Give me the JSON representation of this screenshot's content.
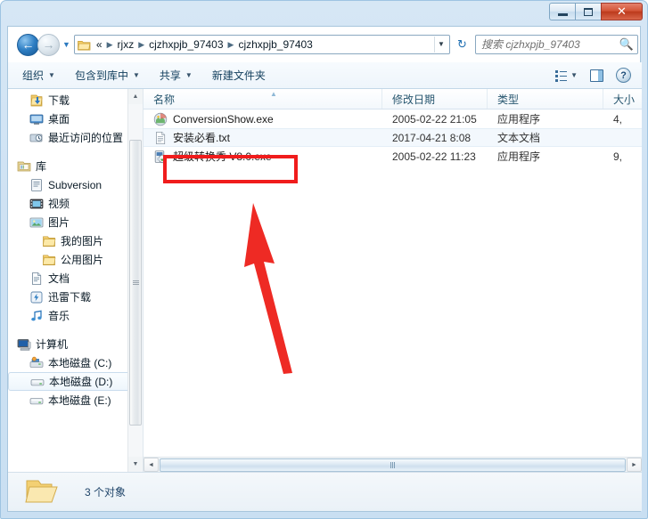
{
  "window": {
    "controls": {
      "minimize": "minimize-button",
      "maximize": "maximize-button",
      "close_label": "✕"
    }
  },
  "nav": {
    "back_glyph": "←",
    "forward_glyph": "→",
    "recent_caret": "▼",
    "breadcrumbs": [
      {
        "label": "«"
      },
      {
        "label": "rjxz"
      },
      {
        "label": "cjzhxpjb_97403"
      },
      {
        "label": "cjzhxpjb_97403"
      }
    ],
    "address_dropdown_glyph": "▼",
    "refresh_glyph": "↻",
    "search": {
      "placeholder": "搜索 cjzhxpjb_97403",
      "value": "",
      "icon": "search-icon"
    }
  },
  "toolbar": {
    "items": [
      {
        "label": "组织",
        "caret": "▼"
      },
      {
        "label": "包含到库中",
        "caret": "▼"
      },
      {
        "label": "共享",
        "caret": "▼"
      },
      {
        "label": "新建文件夹",
        "caret": ""
      }
    ],
    "view_caret": "▼",
    "help_label": "?"
  },
  "sidebar": {
    "items": [
      {
        "label": "下载",
        "icon": "downloads-icon",
        "indent": 1,
        "selected": false
      },
      {
        "label": "桌面",
        "icon": "desktop-icon",
        "indent": 1,
        "selected": false
      },
      {
        "label": "最近访问的位置",
        "icon": "recent-places-icon",
        "indent": 1,
        "selected": false
      },
      {
        "label": "库",
        "icon": "library-icon",
        "indent": 0,
        "selected": false,
        "gap_before": true
      },
      {
        "label": "Subversion",
        "icon": "subversion-icon",
        "indent": 1,
        "selected": false
      },
      {
        "label": "视频",
        "icon": "videos-icon",
        "indent": 1,
        "selected": false
      },
      {
        "label": "图片",
        "icon": "pictures-icon",
        "indent": 1,
        "selected": false
      },
      {
        "label": "我的图片",
        "icon": "folder-icon",
        "indent": 2,
        "selected": false
      },
      {
        "label": "公用图片",
        "icon": "folder-icon",
        "indent": 2,
        "selected": false
      },
      {
        "label": "文档",
        "icon": "documents-icon",
        "indent": 1,
        "selected": false
      },
      {
        "label": "迅雷下载",
        "icon": "thunder-download-icon",
        "indent": 1,
        "selected": false
      },
      {
        "label": "音乐",
        "icon": "music-icon",
        "indent": 1,
        "selected": false
      },
      {
        "label": "计算机",
        "icon": "computer-icon",
        "indent": 0,
        "selected": false,
        "gap_before": true
      },
      {
        "label": "本地磁盘 (C:)",
        "icon": "system-drive-icon",
        "indent": 1,
        "selected": false
      },
      {
        "label": "本地磁盘 (D:)",
        "icon": "drive-icon",
        "indent": 1,
        "selected": true
      },
      {
        "label": "本地磁盘 (E:)",
        "icon": "drive-icon",
        "indent": 1,
        "selected": false
      }
    ],
    "scroll": {
      "up_glyph": "▲",
      "down_glyph": "▼"
    }
  },
  "filelist": {
    "columns": [
      {
        "key": "name",
        "label": "名称"
      },
      {
        "key": "date",
        "label": "修改日期"
      },
      {
        "key": "type",
        "label": "类型"
      },
      {
        "key": "size",
        "label": "大小"
      }
    ],
    "sort_caret": "▲",
    "rows": [
      {
        "name": "ConversionShow.exe",
        "date": "2005-02-22 21:05",
        "type": "应用程序",
        "size": "4,",
        "icon": "application-icon",
        "alt": false
      },
      {
        "name": "安装必看.txt",
        "date": "2017-04-21 8:08",
        "type": "文本文档",
        "size": "",
        "icon": "text-file-icon",
        "alt": true
      },
      {
        "name": "超级转换秀 V8.0.exe",
        "date": "2005-02-22 11:23",
        "type": "应用程序",
        "size": "9,",
        "icon": "installer-icon",
        "alt": false
      }
    ],
    "hscroll": {
      "left_glyph": "◄",
      "right_glyph": "►"
    }
  },
  "statusbar": {
    "text": "3 个对象",
    "icon": "open-folder-icon"
  },
  "annotations": {
    "highlight_box": {
      "target": "超级转换秀 V8.0.exe",
      "color": "#f01c1c"
    },
    "arrow": {
      "color": "#ee2a24",
      "points_to": "超级转换秀 V8.0.exe"
    }
  },
  "colors": {
    "accent": "#2f7fc4",
    "frame": "#cfe2f3",
    "annotation": "#f01c1c"
  }
}
